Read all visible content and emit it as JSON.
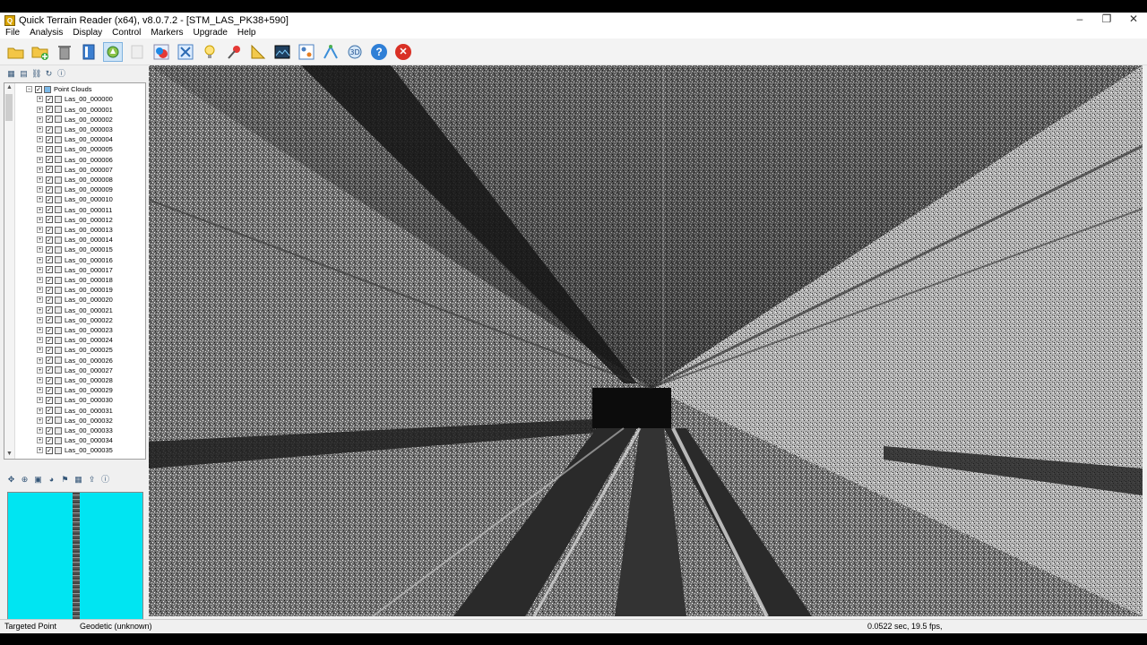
{
  "window": {
    "title": "Quick Terrain Reader (x64), v8.0.7.2 - [STM_LAS_PK38+590]",
    "controls": [
      "–",
      "❐",
      "✕"
    ]
  },
  "menu": [
    "File",
    "Analysis",
    "Display",
    "Control",
    "Markers",
    "Upgrade",
    "Help"
  ],
  "toolbar": {
    "buttons": [
      "open-folder-icon",
      "add-folder-icon",
      "delete-icon",
      "bookmark-icon",
      "select-icon",
      "blank-icon",
      "color-icon",
      "zoom-extents-icon",
      "light-bulb-icon",
      "pin-icon",
      "ruler-icon",
      "image-icon",
      "settings-icon",
      "profile-icon",
      "view-3d-icon",
      "help-icon",
      "close-icon"
    ],
    "help_glyph": "?",
    "close_glyph": "✕"
  },
  "tree": {
    "root_label": "Point Clouds",
    "items": [
      "Las_00_000000",
      "Las_00_000001",
      "Las_00_000002",
      "Las_00_000003",
      "Las_00_000004",
      "Las_00_000005",
      "Las_00_000006",
      "Las_00_000007",
      "Las_00_000008",
      "Las_00_000009",
      "Las_00_000010",
      "Las_00_000011",
      "Las_00_000012",
      "Las_00_000013",
      "Las_00_000014",
      "Las_00_000015",
      "Las_00_000016",
      "Las_00_000017",
      "Las_00_000018",
      "Las_00_000019",
      "Las_00_000020",
      "Las_00_000021",
      "Las_00_000022",
      "Las_00_000023",
      "Las_00_000024",
      "Las_00_000025",
      "Las_00_000026",
      "Las_00_000027",
      "Las_00_000028",
      "Las_00_000029",
      "Las_00_000030",
      "Las_00_000031",
      "Las_00_000032",
      "Las_00_000033",
      "Las_00_000034",
      "Las_00_000035"
    ]
  },
  "status": {
    "targeted_point": "Targeted Point",
    "projection": "Geodetic (unknown)",
    "timing": "0.0522 sec, 19.5 fps,"
  },
  "colors": {
    "minimap_bg": "#00e5f2",
    "selected_tool": "#cde4f7"
  }
}
